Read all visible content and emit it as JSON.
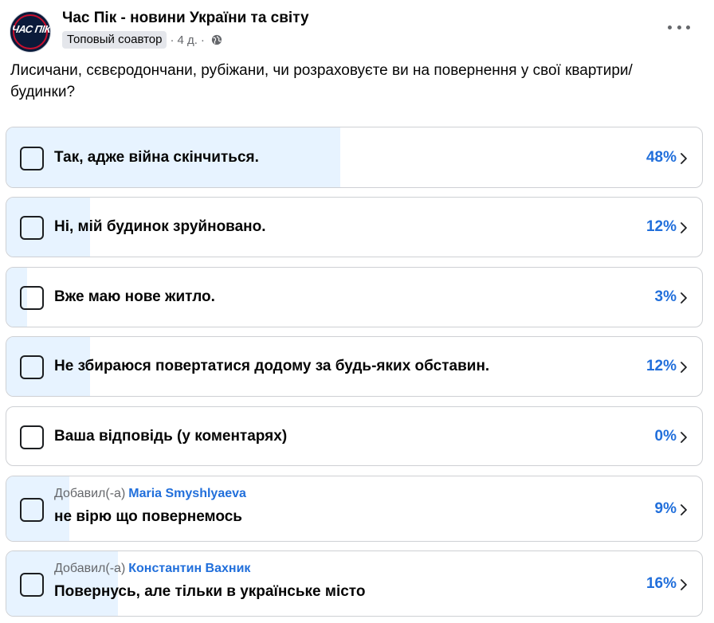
{
  "post": {
    "page_name": "Час Пік - новини України та світу",
    "avatar_text": "ЧАС ПІК",
    "badge": "Топовый соавтор",
    "time": "4 д.",
    "separator": "·",
    "privacy_icon": "globe-icon",
    "menu_icon": "more-icon",
    "question": "Лисичани, сєвєродончани, рубіжани, чи розраховуєте ви на повернення у свої квартири/будинки?"
  },
  "colors": {
    "accent": "#216fdb",
    "fill": "#e7f3ff",
    "border": "#ced0d4",
    "secondary_text": "#65676b"
  },
  "poll": {
    "options": [
      {
        "label": "Так, адже війна скінчиться.",
        "percent_text": "48%",
        "percent": 48
      },
      {
        "label": "Ні, мій будинок зруйновано.",
        "percent_text": "12%",
        "percent": 12
      },
      {
        "label": "Вже маю нове житло.",
        "percent_text": "3%",
        "percent": 3
      },
      {
        "label": "Не збираюся повертатися додому за будь-яких обставин.",
        "percent_text": "12%",
        "percent": 12
      },
      {
        "label": "Ваша відповідь (у коментарях)",
        "percent_text": "0%",
        "percent": 0
      },
      {
        "added_by": "Добавил(-а)",
        "author": "Maria Smyshlyaeva",
        "label": "не вірю що повернемось",
        "percent_text": "9%",
        "percent": 9
      },
      {
        "added_by": "Добавил(-а)",
        "author": "Константин Вахник",
        "label": "Повернусь, але тільки в українське місто",
        "percent_text": "16%",
        "percent": 16
      }
    ]
  }
}
